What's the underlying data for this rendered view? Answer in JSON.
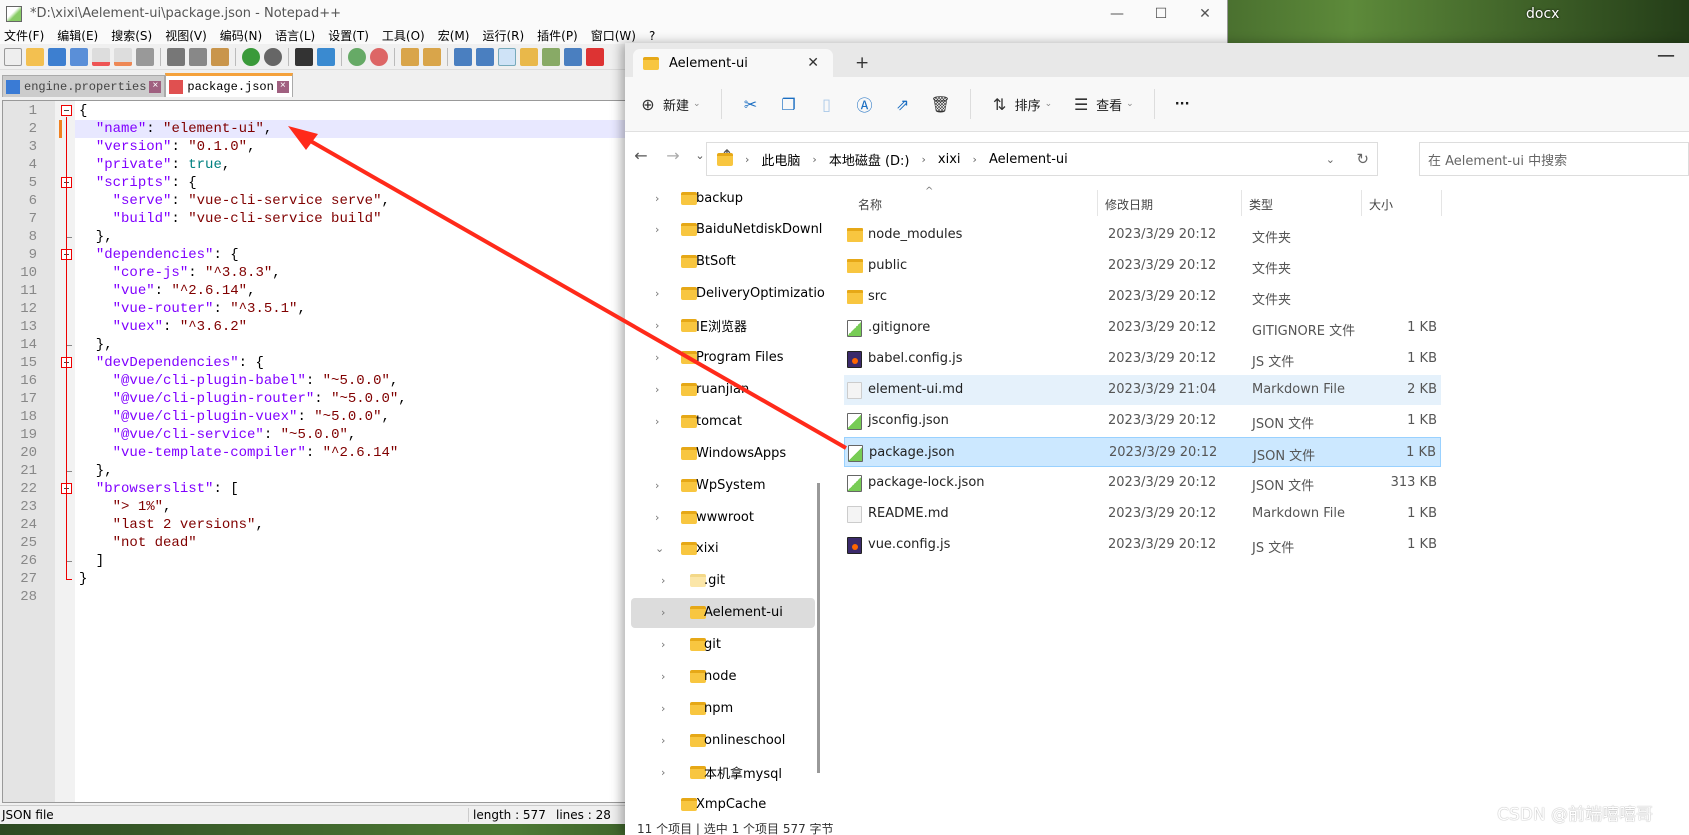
{
  "desktop": {
    "labels": [
      "docx"
    ]
  },
  "notepad": {
    "title": "*D:\\xixi\\Aelement-ui\\package.json - Notepad++",
    "window_buttons": [
      "—",
      "☐",
      "✕"
    ],
    "menu": [
      "文件(F)",
      "编辑(E)",
      "搜索(S)",
      "视图(V)",
      "编码(N)",
      "语言(L)",
      "设置(T)",
      "工具(O)",
      "宏(M)",
      "运行(R)",
      "插件(P)",
      "窗口(W)",
      "?"
    ],
    "tabs": [
      {
        "label": "engine.properties",
        "active": false
      },
      {
        "label": "package.json",
        "active": true
      }
    ],
    "current_line": 2,
    "lines": [
      [
        [
          "p",
          "{"
        ]
      ],
      [
        [
          "p",
          "  "
        ],
        [
          "k",
          "\"name\""
        ],
        [
          "p",
          ": "
        ],
        [
          "s",
          "\"element-ui\""
        ],
        [
          "p",
          ","
        ]
      ],
      [
        [
          "p",
          "  "
        ],
        [
          "k",
          "\"version\""
        ],
        [
          "p",
          ": "
        ],
        [
          "s",
          "\"0.1.0\""
        ],
        [
          "p",
          ","
        ]
      ],
      [
        [
          "p",
          "  "
        ],
        [
          "k",
          "\"private\""
        ],
        [
          "p",
          ": "
        ],
        [
          "b",
          "true"
        ],
        [
          "p",
          ","
        ]
      ],
      [
        [
          "p",
          "  "
        ],
        [
          "k",
          "\"scripts\""
        ],
        [
          "p",
          ": {"
        ]
      ],
      [
        [
          "p",
          "    "
        ],
        [
          "k",
          "\"serve\""
        ],
        [
          "p",
          ": "
        ],
        [
          "s",
          "\"vue-cli-service serve\""
        ],
        [
          "p",
          ","
        ]
      ],
      [
        [
          "p",
          "    "
        ],
        [
          "k",
          "\"build\""
        ],
        [
          "p",
          ": "
        ],
        [
          "s",
          "\"vue-cli-service build\""
        ]
      ],
      [
        [
          "p",
          "  },"
        ]
      ],
      [
        [
          "p",
          "  "
        ],
        [
          "k",
          "\"dependencies\""
        ],
        [
          "p",
          ": {"
        ]
      ],
      [
        [
          "p",
          "    "
        ],
        [
          "k",
          "\"core-js\""
        ],
        [
          "p",
          ": "
        ],
        [
          "s",
          "\"^3.8.3\""
        ],
        [
          "p",
          ","
        ]
      ],
      [
        [
          "p",
          "    "
        ],
        [
          "k",
          "\"vue\""
        ],
        [
          "p",
          ": "
        ],
        [
          "s",
          "\"^2.6.14\""
        ],
        [
          "p",
          ","
        ]
      ],
      [
        [
          "p",
          "    "
        ],
        [
          "k",
          "\"vue-router\""
        ],
        [
          "p",
          ": "
        ],
        [
          "s",
          "\"^3.5.1\""
        ],
        [
          "p",
          ","
        ]
      ],
      [
        [
          "p",
          "    "
        ],
        [
          "k",
          "\"vuex\""
        ],
        [
          "p",
          ": "
        ],
        [
          "s",
          "\"^3.6.2\""
        ]
      ],
      [
        [
          "p",
          "  },"
        ]
      ],
      [
        [
          "p",
          "  "
        ],
        [
          "k",
          "\"devDependencies\""
        ],
        [
          "p",
          ": {"
        ]
      ],
      [
        [
          "p",
          "    "
        ],
        [
          "k",
          "\"@vue/cli-plugin-babel\""
        ],
        [
          "p",
          ": "
        ],
        [
          "s",
          "\"~5.0.0\""
        ],
        [
          "p",
          ","
        ]
      ],
      [
        [
          "p",
          "    "
        ],
        [
          "k",
          "\"@vue/cli-plugin-router\""
        ],
        [
          "p",
          ": "
        ],
        [
          "s",
          "\"~5.0.0\""
        ],
        [
          "p",
          ","
        ]
      ],
      [
        [
          "p",
          "    "
        ],
        [
          "k",
          "\"@vue/cli-plugin-vuex\""
        ],
        [
          "p",
          ": "
        ],
        [
          "s",
          "\"~5.0.0\""
        ],
        [
          "p",
          ","
        ]
      ],
      [
        [
          "p",
          "    "
        ],
        [
          "k",
          "\"@vue/cli-service\""
        ],
        [
          "p",
          ": "
        ],
        [
          "s",
          "\"~5.0.0\""
        ],
        [
          "p",
          ","
        ]
      ],
      [
        [
          "p",
          "    "
        ],
        [
          "k",
          "\"vue-template-compiler\""
        ],
        [
          "p",
          ": "
        ],
        [
          "s",
          "\"^2.6.14\""
        ]
      ],
      [
        [
          "p",
          "  },"
        ]
      ],
      [
        [
          "p",
          "  "
        ],
        [
          "k",
          "\"browserslist\""
        ],
        [
          "p",
          ": ["
        ]
      ],
      [
        [
          "p",
          "    "
        ],
        [
          "s",
          "\"> 1%\""
        ],
        [
          "p",
          ","
        ]
      ],
      [
        [
          "p",
          "    "
        ],
        [
          "s",
          "\"last 2 versions\""
        ],
        [
          "p",
          ","
        ]
      ],
      [
        [
          "p",
          "    "
        ],
        [
          "s",
          "\"not dead\""
        ]
      ],
      [
        [
          "p",
          "  ]"
        ]
      ],
      [
        [
          "p",
          "}"
        ]
      ],
      []
    ],
    "status": {
      "type": "JSON file",
      "length": "length : 577",
      "lines": "lines : 28"
    }
  },
  "explorer": {
    "tab": "Aelement-ui",
    "toolbar": {
      "new": "新建",
      "sort": "排序",
      "view": "查看",
      "more": "···"
    },
    "breadcrumb": [
      "此电脑",
      "本地磁盘 (D:)",
      "xixi",
      "Aelement-ui"
    ],
    "search_placeholder": "在 Aelement-ui 中搜索",
    "columns": [
      "名称",
      "修改日期",
      "类型",
      "大小"
    ],
    "nav": [
      {
        "label": "backup",
        "level": 0,
        "chevron": "›"
      },
      {
        "label": "BaiduNetdiskDownl",
        "level": 0,
        "chevron": "›"
      },
      {
        "label": "BtSoft",
        "level": 0,
        "chevron": ""
      },
      {
        "label": "DeliveryOptimizatio",
        "level": 0,
        "chevron": "›"
      },
      {
        "label": "IE浏览器",
        "level": 0,
        "chevron": "›"
      },
      {
        "label": "Program Files",
        "level": 0,
        "chevron": "›"
      },
      {
        "label": "ruanjian",
        "level": 0,
        "chevron": "›"
      },
      {
        "label": "tomcat",
        "level": 0,
        "chevron": "›"
      },
      {
        "label": "WindowsApps",
        "level": 0,
        "chevron": ""
      },
      {
        "label": "WpSystem",
        "level": 0,
        "chevron": "›"
      },
      {
        "label": "wwwroot",
        "level": 0,
        "chevron": "›"
      },
      {
        "label": "xixi",
        "level": 0,
        "chevron": "⌄"
      },
      {
        "label": ".git",
        "level": 1,
        "chevron": "›",
        "hidden": true
      },
      {
        "label": "Aelement-ui",
        "level": 1,
        "chevron": "›",
        "selected": true
      },
      {
        "label": "git",
        "level": 1,
        "chevron": "›"
      },
      {
        "label": "node",
        "level": 1,
        "chevron": "›"
      },
      {
        "label": "npm",
        "level": 1,
        "chevron": "›"
      },
      {
        "label": "onlineschool",
        "level": 1,
        "chevron": "›"
      },
      {
        "label": "本机拿mysql",
        "level": 1,
        "chevron": "›"
      },
      {
        "label": "XmpCache",
        "level": 0,
        "chevron": ""
      }
    ],
    "files": [
      {
        "name": "node_modules",
        "date": "2023/3/29 20:12",
        "type": "文件夹",
        "size": "",
        "icon": "folder"
      },
      {
        "name": "public",
        "date": "2023/3/29 20:12",
        "type": "文件夹",
        "size": "",
        "icon": "folder"
      },
      {
        "name": "src",
        "date": "2023/3/29 20:12",
        "type": "文件夹",
        "size": "",
        "icon": "folder"
      },
      {
        "name": ".gitignore",
        "date": "2023/3/29 20:12",
        "type": "GITIGNORE 文件",
        "size": "1 KB",
        "icon": "txt"
      },
      {
        "name": "babel.config.js",
        "date": "2023/3/29 20:12",
        "type": "JS 文件",
        "size": "1 KB",
        "icon": "js"
      },
      {
        "name": "element-ui.md",
        "date": "2023/3/29 21:04",
        "type": "Markdown File",
        "size": "2 KB",
        "icon": "md",
        "state": "hover"
      },
      {
        "name": "jsconfig.json",
        "date": "2023/3/29 20:12",
        "type": "JSON 文件",
        "size": "1 KB",
        "icon": "txt"
      },
      {
        "name": "package.json",
        "date": "2023/3/29 20:12",
        "type": "JSON 文件",
        "size": "1 KB",
        "icon": "txt",
        "state": "selected"
      },
      {
        "name": "package-lock.json",
        "date": "2023/3/29 20:12",
        "type": "JSON 文件",
        "size": "313 KB",
        "icon": "txt"
      },
      {
        "name": "README.md",
        "date": "2023/3/29 20:12",
        "type": "Markdown File",
        "size": "1 KB",
        "icon": "md"
      },
      {
        "name": "vue.config.js",
        "date": "2023/3/29 20:12",
        "type": "JS 文件",
        "size": "1 KB",
        "icon": "js"
      }
    ],
    "status": "11 个项目  |  选中 1 个项目  577 字节"
  },
  "watermark": "CSDN @前端嘻嘻哥",
  "annotation_color": "#ff2a1a"
}
